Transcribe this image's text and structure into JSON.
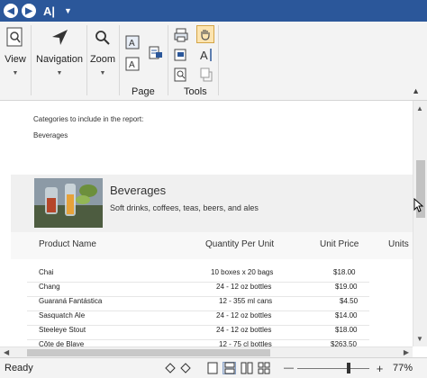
{
  "titlebar": {
    "font_glyph": "A|"
  },
  "ribbon": {
    "view_label": "View",
    "navigation_label": "Navigation",
    "zoom_label": "Zoom",
    "page_group_label": "Page",
    "tools_group_label": "Tools"
  },
  "document": {
    "filter_label": "Categories to include in the report:",
    "filter_value": "Beverages",
    "category": {
      "name": "Beverages",
      "description": "Soft drinks, coffees, teas, beers, and ales"
    },
    "columns": [
      "Product Name",
      "Quantity Per Unit",
      "Unit Price",
      "Units"
    ],
    "rows": [
      {
        "name": "Chai",
        "qty": "10 boxes x 20 bags",
        "price": "$18.00"
      },
      {
        "name": "Chang",
        "qty": "24 - 12 oz bottles",
        "price": "$19.00"
      },
      {
        "name": "Guaraná Fantástica",
        "qty": "12 - 355 ml cans",
        "price": "$4.50"
      },
      {
        "name": "Sasquatch Ale",
        "qty": "24 - 12 oz bottles",
        "price": "$14.00"
      },
      {
        "name": "Steeleye Stout",
        "qty": "24 - 12 oz bottles",
        "price": "$18.00"
      },
      {
        "name": "Côte de Blaye",
        "qty": "12 - 75 cl bottles",
        "price": "$263.50"
      }
    ]
  },
  "statusbar": {
    "status": "Ready",
    "zoom_minus": "—",
    "zoom_plus": "+",
    "zoom_value": "77%",
    "zoom_fraction": 0.77
  },
  "colors": {
    "titlebar": "#2b579a",
    "accent": "#2b579a"
  }
}
